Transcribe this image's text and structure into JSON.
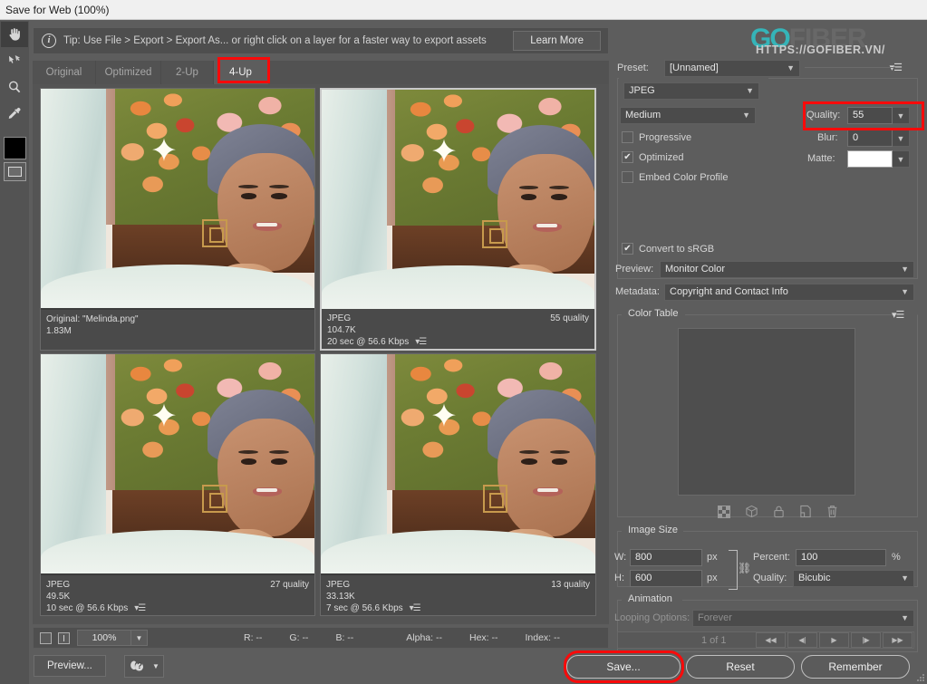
{
  "window": {
    "title": "Save for Web (100%)"
  },
  "toolbar": {
    "tools": [
      {
        "name": "hand-tool",
        "selected": true
      },
      {
        "name": "slice-select-tool",
        "selected": false
      },
      {
        "name": "zoom-tool",
        "selected": false
      },
      {
        "name": "eyedropper-tool",
        "selected": false
      }
    ],
    "foreground_swatch_color": "#000000"
  },
  "tip": {
    "text": "Tip: Use File > Export > Export As...  or right click on a layer for a faster way to export assets",
    "learn_more_label": "Learn More"
  },
  "tabs": [
    {
      "label": "Original",
      "active": false
    },
    {
      "label": "Optimized",
      "active": false
    },
    {
      "label": "2-Up",
      "active": false
    },
    {
      "label": "4-Up",
      "active": true
    }
  ],
  "previews": [
    {
      "id": "original",
      "selected": false,
      "title": "Original: \"Melinda.png\"",
      "size": "1.83M",
      "quality": "",
      "speed": "",
      "has_menu": false
    },
    {
      "id": "optimized-55",
      "selected": true,
      "title": "JPEG",
      "size": "104.7K",
      "quality": "55 quality",
      "speed": "20 sec @ 56.6 Kbps",
      "has_menu": true
    },
    {
      "id": "optimized-27",
      "selected": false,
      "title": "JPEG",
      "size": "49.5K",
      "quality": "27 quality",
      "speed": "10 sec @ 56.6 Kbps",
      "has_menu": true
    },
    {
      "id": "optimized-13",
      "selected": false,
      "title": "JPEG",
      "size": "33.13K",
      "quality": "13 quality",
      "speed": "7 sec @ 56.6 Kbps",
      "has_menu": true
    }
  ],
  "settings": {
    "preset_label": "Preset:",
    "preset_value": "[Unnamed]",
    "format_value": "JPEG",
    "compression_value": "Medium",
    "quality_label": "Quality:",
    "quality_value": "55",
    "blur_label": "Blur:",
    "blur_value": "0",
    "matte_label": "Matte:",
    "matte_color": "#ffffff",
    "progressive_label": "Progressive",
    "progressive_checked": false,
    "optimized_label": "Optimized",
    "optimized_checked": true,
    "embed_profile_label": "Embed Color Profile",
    "embed_profile_checked": false,
    "convert_srgb_label": "Convert to sRGB",
    "convert_srgb_checked": true,
    "preview_label": "Preview:",
    "preview_value": "Monitor Color",
    "metadata_label": "Metadata:",
    "metadata_value": "Copyright and Contact Info"
  },
  "color_table": {
    "title": "Color Table",
    "icons": [
      "transparency-icon",
      "web-safe-cube-icon",
      "lock-icon",
      "new-color-icon",
      "delete-color-icon"
    ]
  },
  "image_size": {
    "title": "Image Size",
    "w_label": "W:",
    "w_value": "800",
    "w_unit": "px",
    "h_label": "H:",
    "h_value": "600",
    "h_unit": "px",
    "percent_label": "Percent:",
    "percent_value": "100",
    "percent_unit": "%",
    "quality_label": "Quality:",
    "quality_value": "Bicubic"
  },
  "animation": {
    "title": "Animation",
    "looping_label": "Looping Options:",
    "looping_value": "Forever",
    "frame_counter": "1 of 1",
    "controls": [
      "first-frame",
      "previous-frame",
      "play",
      "next-frame",
      "last-frame"
    ]
  },
  "status": {
    "zoom_value": "100%",
    "readouts": [
      {
        "label": "R:",
        "value": "--"
      },
      {
        "label": "G:",
        "value": "--"
      },
      {
        "label": "B:",
        "value": "--"
      }
    ],
    "readouts2": [
      {
        "label": "Alpha:",
        "value": "--"
      },
      {
        "label": "Hex:",
        "value": "--"
      },
      {
        "label": "Index:",
        "value": "--"
      }
    ]
  },
  "footer": {
    "preview_label": "Preview...",
    "save_label": "Save...",
    "reset_label": "Reset",
    "remember_label": "Remember"
  },
  "watermark": {
    "brand_first": "GO",
    "brand_second": "FIBER",
    "url": "HTTPS://GOFIBER.VN/",
    "accent_color": "#2fc4c9"
  },
  "annotations": {
    "highlight_color": "#fa0a0a",
    "targets": [
      "4-up-tab",
      "quality-field",
      "save-button"
    ]
  }
}
